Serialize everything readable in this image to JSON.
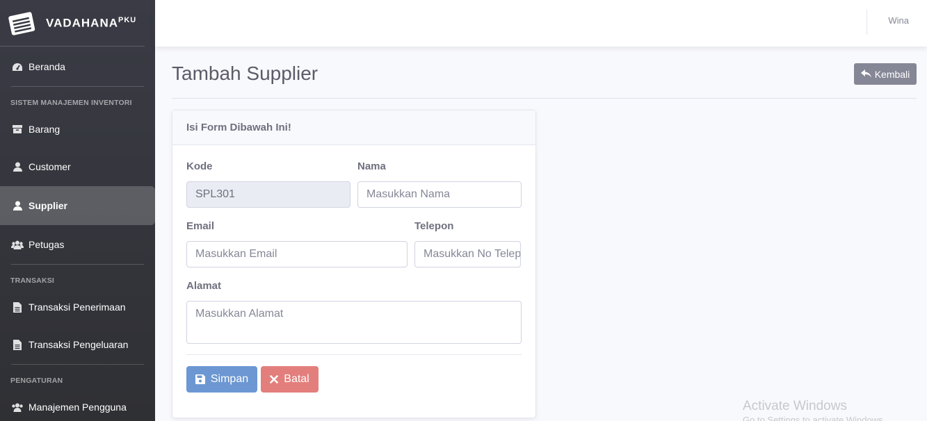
{
  "brand": {
    "name": "VADAHANA",
    "suffix": "PKU"
  },
  "sidebar": {
    "home": "Beranda",
    "section_inventory": "SISTEM MANAJEMEN INVENTORI",
    "items_inventory": [
      "Barang",
      "Customer",
      "Supplier",
      "Petugas"
    ],
    "section_transaction": "TRANSAKSI",
    "items_transaction": [
      "Transaksi Penerimaan",
      "Transaksi Pengeluaran"
    ],
    "section_settings": "PENGATURAN",
    "items_settings": [
      "Manajemen Pengguna"
    ],
    "active": "Supplier"
  },
  "topbar": {
    "user": "Wina"
  },
  "page": {
    "title": "Tambah Supplier",
    "back_label": "Kembali"
  },
  "form": {
    "header": "Isi Form Dibawah Ini!",
    "kode_label": "Kode",
    "kode_value": "SPL301",
    "nama_label": "Nama",
    "nama_placeholder": "Masukkan Nama",
    "email_label": "Email",
    "email_placeholder": "Masukkan Email",
    "telepon_label": "Telepon",
    "telepon_placeholder": "Masukkan No Telepon",
    "alamat_label": "Alamat",
    "alamat_placeholder": "Masukkan Alamat",
    "save_label": "Simpan",
    "cancel_label": "Batal"
  },
  "watermark": {
    "line1": "Activate Windows",
    "line2": "Go to Settings to activate Windows."
  },
  "colors": {
    "sidebar": "#3a3b45",
    "save": "#6c97d2",
    "cancel": "#e27f7c",
    "back": "#858796"
  }
}
